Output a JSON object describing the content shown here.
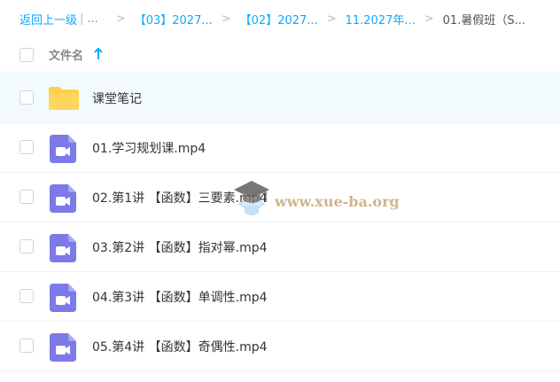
{
  "breadcrumb": {
    "back_label": "返回上一级",
    "pipe": "|",
    "ellipsis": "...",
    "separator": ">",
    "items": [
      "【03】2027...",
      "【02】2027...",
      "11.2027年..."
    ],
    "current": "01.暑假班（S..."
  },
  "header": {
    "column_label": "文件名",
    "sort_icon": "arrow-up-icon"
  },
  "files": [
    {
      "name": "课堂笔记",
      "type": "folder",
      "icon": "folder-icon"
    },
    {
      "name": "01.学习规划课.mp4",
      "type": "video",
      "icon": "video-file-icon"
    },
    {
      "name": "02.第1讲 【函数】三要素.mp4",
      "type": "video",
      "icon": "video-file-icon"
    },
    {
      "name": "03.第2讲 【函数】指对幂.mp4",
      "type": "video",
      "icon": "video-file-icon"
    },
    {
      "name": "04.第3讲 【函数】单调性.mp4",
      "type": "video",
      "icon": "video-file-icon"
    },
    {
      "name": "05.第4讲 【函数】奇偶性.mp4",
      "type": "video",
      "icon": "video-file-icon"
    }
  ],
  "watermark": {
    "text": "www.xue-ba.org",
    "icon": "graduation-cap-icon"
  },
  "colors": {
    "link": "#09aaff",
    "video_icon": "#7c79e8",
    "folder": "#ffd65c",
    "highlight_row": "#f3fafe"
  }
}
